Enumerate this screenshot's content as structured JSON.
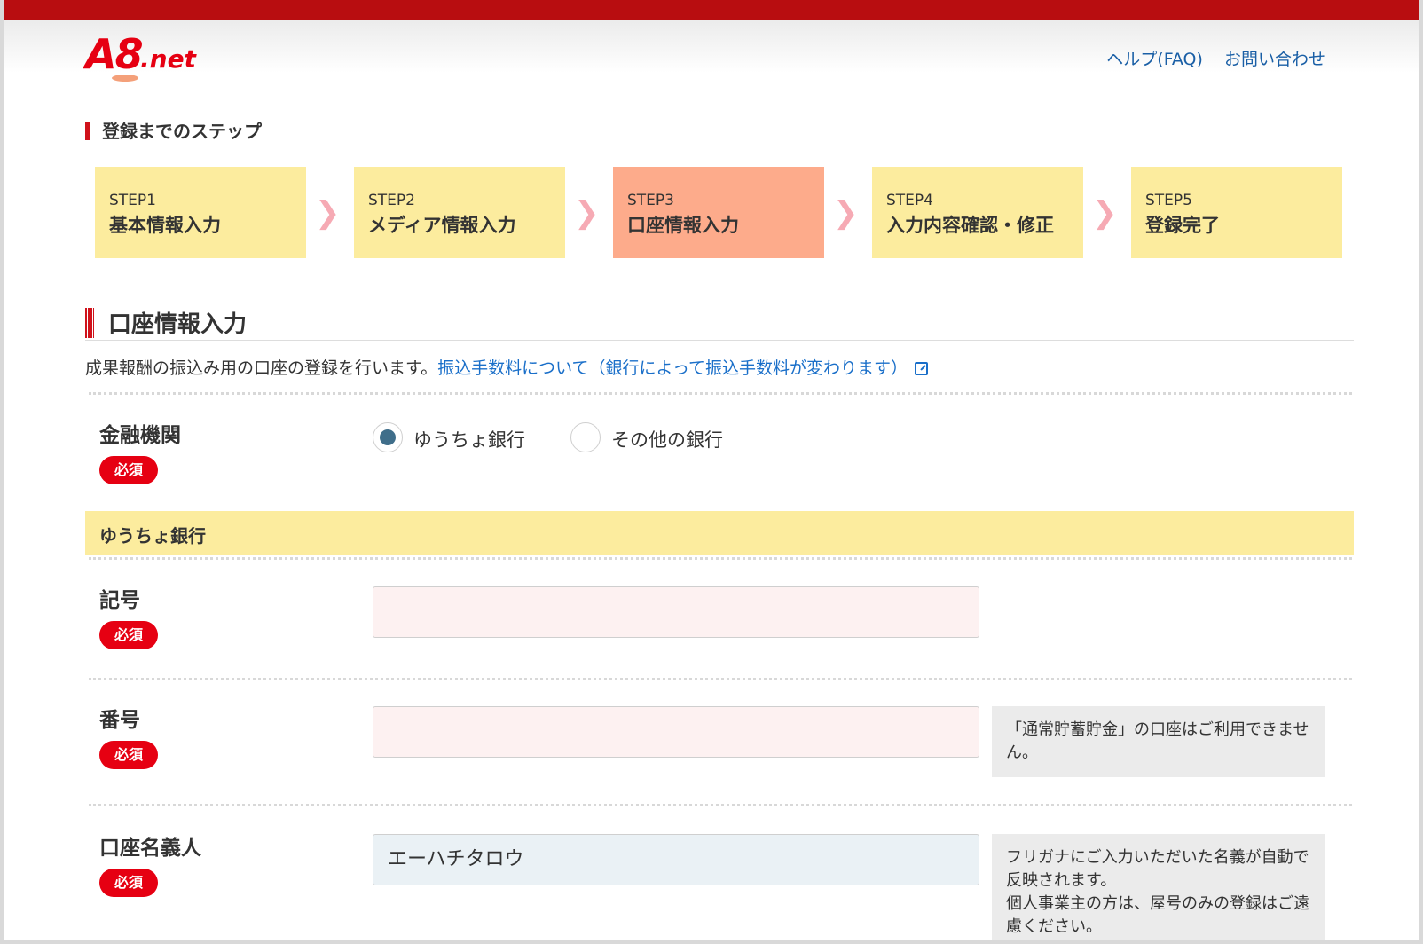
{
  "header": {
    "logo": "A8.net",
    "links": [
      "ヘルプ(FAQ)",
      "お問い合わせ"
    ]
  },
  "steps_title": "登録までのステップ",
  "steps": [
    {
      "num": "STEP1",
      "label": "基本情報入力",
      "active": false
    },
    {
      "num": "STEP2",
      "label": "メディア情報入力",
      "active": false
    },
    {
      "num": "STEP3",
      "label": "口座情報入力",
      "active": true
    },
    {
      "num": "STEP4",
      "label": "入力内容確認・修正",
      "active": false
    },
    {
      "num": "STEP5",
      "label": "登録完了",
      "active": false
    }
  ],
  "section_title": "口座情報入力",
  "description": {
    "text": "成果報酬の振込み用の口座の登録を行います。",
    "link": "振込手数料について（銀行によって振込手数料が変わります）"
  },
  "required_label": "必須",
  "form": {
    "institution": {
      "label": "金融機関",
      "options": [
        "ゆうちょ銀行",
        "その他の銀行"
      ],
      "selected": "ゆうちょ銀行"
    },
    "band_title": "ゆうちょ銀行",
    "symbol": {
      "label": "記号",
      "value": ""
    },
    "number": {
      "label": "番号",
      "value": "",
      "note": "「通常貯蓄貯金」の口座はご利用できません。"
    },
    "holder": {
      "label": "口座名義人",
      "value": "エーハチタロウ",
      "note_line1": "フリガナにご入力いただいた名義が自動で反映されます。",
      "note_line2": "個人事業主の方は、屋号のみの登録はご遠慮ください。"
    }
  },
  "colors": {
    "brand_red": "#e60012",
    "step_inactive": "#fcec9e",
    "step_active": "#fdab8b",
    "link_blue": "#1a6fc9"
  }
}
